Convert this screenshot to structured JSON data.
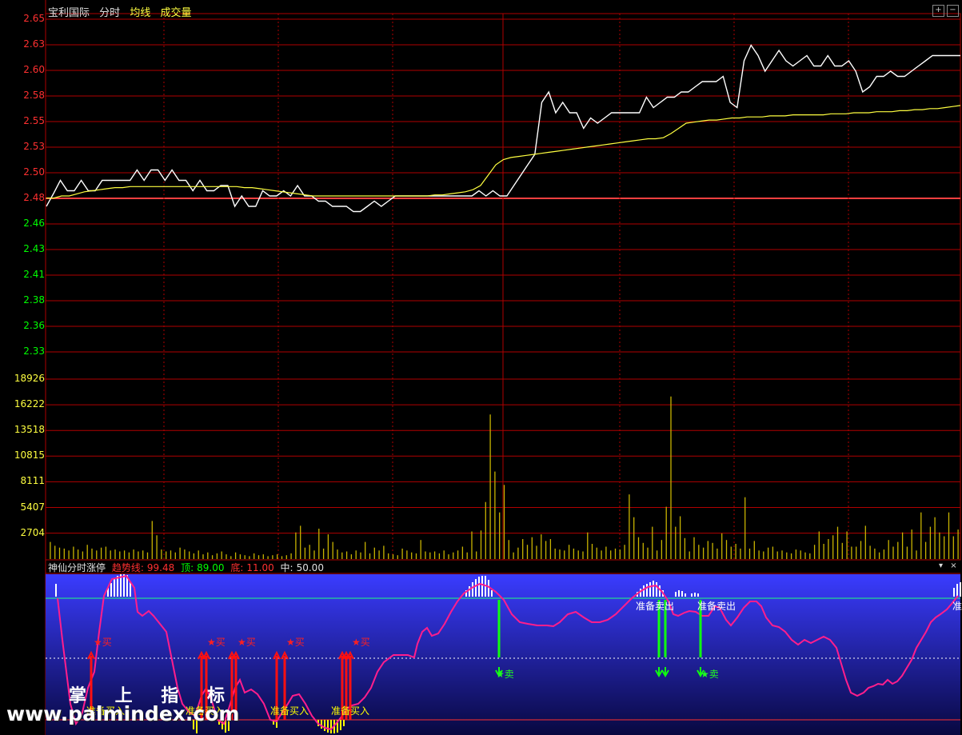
{
  "header": {
    "stock_name": "宝利国际",
    "tab_intraday": "分时",
    "tab_avg": "均线",
    "tab_volume": "成交量"
  },
  "price_axis": {
    "ticks": [
      "2.65",
      "2.63",
      "2.60",
      "2.58",
      "2.55",
      "2.53",
      "2.50",
      "2.48",
      "2.46",
      "2.43",
      "2.41",
      "2.38",
      "2.36",
      "2.33"
    ],
    "reference_price": 2.48
  },
  "volume_axis": {
    "ticks": [
      "18926",
      "16222",
      "13518",
      "10815",
      "8111",
      "5407",
      "2704"
    ]
  },
  "indicator": {
    "name": "神仙分时涨停",
    "trend_label": "趋势线:",
    "trend_value": "99.48",
    "top_label": "顶:",
    "top_value": "89.00",
    "bottom_label": "底:",
    "bottom_value": "11.00",
    "mid_label": "中:",
    "mid_value": "50.00",
    "buy_marker": "★买",
    "sell_marker": "★卖",
    "prepare_buy": "准备买入",
    "prepare_sell": "准备卖出",
    "prepare_sell_cut": "准"
  },
  "watermark": {
    "line1": "掌 上 指 标",
    "line2": "www.palmindex.com"
  },
  "colors": {
    "up": "#ff3030",
    "down": "#00ff00",
    "price_line": "#ffffff",
    "avg_line": "#ffff40",
    "volume": "#c8b400",
    "grid": "#b00000",
    "indicator_line": "#ff1e8c",
    "label_yellow": "#ffff00"
  },
  "chart_data": {
    "type": "line",
    "series": [
      {
        "values": [
          2.47,
          2.482,
          2.495,
          2.485,
          2.485,
          2.495,
          2.485,
          2.485,
          2.495,
          2.495,
          2.495,
          2.495,
          2.495,
          2.505,
          2.495,
          2.505,
          2.505,
          2.495,
          2.505,
          2.495,
          2.495,
          2.485,
          2.495,
          2.485,
          2.485,
          2.49,
          2.49,
          2.47,
          2.48,
          2.47,
          2.47,
          2.485,
          2.48,
          2.48,
          2.485,
          2.48,
          2.49,
          2.48,
          2.48,
          2.475,
          2.475,
          2.47,
          2.47,
          2.47,
          2.465,
          2.465,
          2.47,
          2.475,
          2.47,
          2.475,
          2.48,
          2.48,
          2.48,
          2.48,
          2.48,
          2.48,
          2.48,
          2.48,
          2.48,
          2.48,
          2.48,
          2.48,
          2.485,
          2.48,
          2.485,
          2.48,
          2.48,
          2.49,
          2.5,
          2.51,
          2.52,
          2.57,
          2.58,
          2.56,
          2.57,
          2.56,
          2.56,
          2.545,
          2.555,
          2.55,
          2.555,
          2.56,
          2.56,
          2.56,
          2.56,
          2.56,
          2.575,
          2.565,
          2.57,
          2.575,
          2.575,
          2.58,
          2.58,
          2.585,
          2.59,
          2.59,
          2.59,
          2.595,
          2.57,
          2.565,
          2.61,
          2.625,
          2.615,
          2.6,
          2.61,
          2.62,
          2.61,
          2.605,
          2.61,
          2.615,
          2.605,
          2.605,
          2.615,
          2.605,
          2.605,
          2.61,
          2.6,
          2.58,
          2.585,
          2.595,
          2.595,
          2.6,
          2.595,
          2.595,
          2.6,
          2.605,
          2.61,
          2.615,
          2.615,
          2.615,
          2.615,
          2.615
        ]
      },
      {
        "values": [
          2.478,
          2.478,
          2.48,
          2.48,
          2.482,
          2.484,
          2.485,
          2.486,
          2.487,
          2.488,
          2.488,
          2.489,
          2.489,
          2.489,
          2.489,
          2.489,
          2.489,
          2.489,
          2.489,
          2.489,
          2.489,
          2.489,
          2.489,
          2.489,
          2.489,
          2.489,
          2.488,
          2.488,
          2.487,
          2.486,
          2.485,
          2.484,
          2.483,
          2.482,
          2.481,
          2.48,
          2.48,
          2.48,
          2.48,
          2.48,
          2.48,
          2.48,
          2.48,
          2.48,
          2.48,
          2.48,
          2.48,
          2.48,
          2.48,
          2.48,
          2.48,
          2.481,
          2.481,
          2.482,
          2.483,
          2.484,
          2.486,
          2.49,
          2.5,
          2.51,
          2.515,
          2.517,
          2.518,
          2.519,
          2.52,
          2.521,
          2.522,
          2.523,
          2.524,
          2.525,
          2.526,
          2.527,
          2.528,
          2.529,
          2.53,
          2.531,
          2.532,
          2.533,
          2.534,
          2.535,
          2.535,
          2.536,
          2.54,
          2.545,
          2.55,
          2.551,
          2.552,
          2.553,
          2.553,
          2.554,
          2.555,
          2.555,
          2.556,
          2.556,
          2.556,
          2.557,
          2.557,
          2.557,
          2.558,
          2.558,
          2.558,
          2.558,
          2.558,
          2.559,
          2.559,
          2.559,
          2.56,
          2.56,
          2.56,
          2.561,
          2.561,
          2.561,
          2.562,
          2.562,
          2.563,
          2.563,
          2.564,
          2.564,
          2.565,
          2.566,
          2.567
        ]
      }
    ],
    "volume": [
      1800,
      1400,
      1200,
      1100,
      900,
      1300,
      1000,
      800,
      1500,
      1100,
      900,
      1200,
      1300,
      900,
      1000,
      800,
      900,
      700,
      1000,
      800,
      900,
      700,
      4000,
      2500,
      1000,
      800,
      900,
      700,
      1200,
      1000,
      800,
      600,
      900,
      500,
      700,
      400,
      600,
      800,
      500,
      300,
      700,
      500,
      400,
      300,
      600,
      400,
      500,
      300,
      400,
      500,
      300,
      400,
      600,
      2800,
      3500,
      1200,
      1500,
      900,
      3200,
      1100,
      2600,
      1800,
      1000,
      700,
      800,
      500,
      900,
      700,
      1800,
      600,
      1200,
      900,
      1400,
      600,
      500,
      400,
      1100,
      900,
      700,
      600,
      2000,
      800,
      700,
      800,
      600,
      900,
      500,
      700,
      900,
      1300,
      700,
      2900,
      800,
      3000,
      6000,
      15200,
      9200,
      4900,
      7800,
      2000,
      700,
      1200,
      2100,
      1500,
      2300,
      1400,
      2600,
      1900,
      2100,
      1100,
      1000,
      900,
      1500,
      1100,
      900,
      800,
      2800,
      1600,
      1200,
      900,
      1300,
      900,
      1100,
      1000,
      1500,
      6800,
      4400,
      2300,
      1700,
      1200,
      3400,
      900,
      2000,
      5500,
      17100,
      3400,
      4500,
      2200,
      800,
      2300,
      1500,
      1200,
      1900,
      1700,
      1100,
      2700,
      2000,
      1300,
      1600,
      1100,
      6500,
      1100,
      1900,
      900,
      800,
      1200,
      1300,
      800,
      900,
      700,
      600,
      1000,
      900,
      700,
      600,
      1500,
      2900,
      1600,
      2100,
      2500,
      3400,
      1700,
      2900,
      1300,
      1300,
      1900,
      3500,
      1400,
      1100,
      700,
      1000,
      2000,
      1300,
      1800,
      2800,
      1300,
      3100,
      900,
      4900,
      1800,
      3400,
      4400,
      2800,
      2400,
      4900,
      2400,
      3100
    ]
  }
}
